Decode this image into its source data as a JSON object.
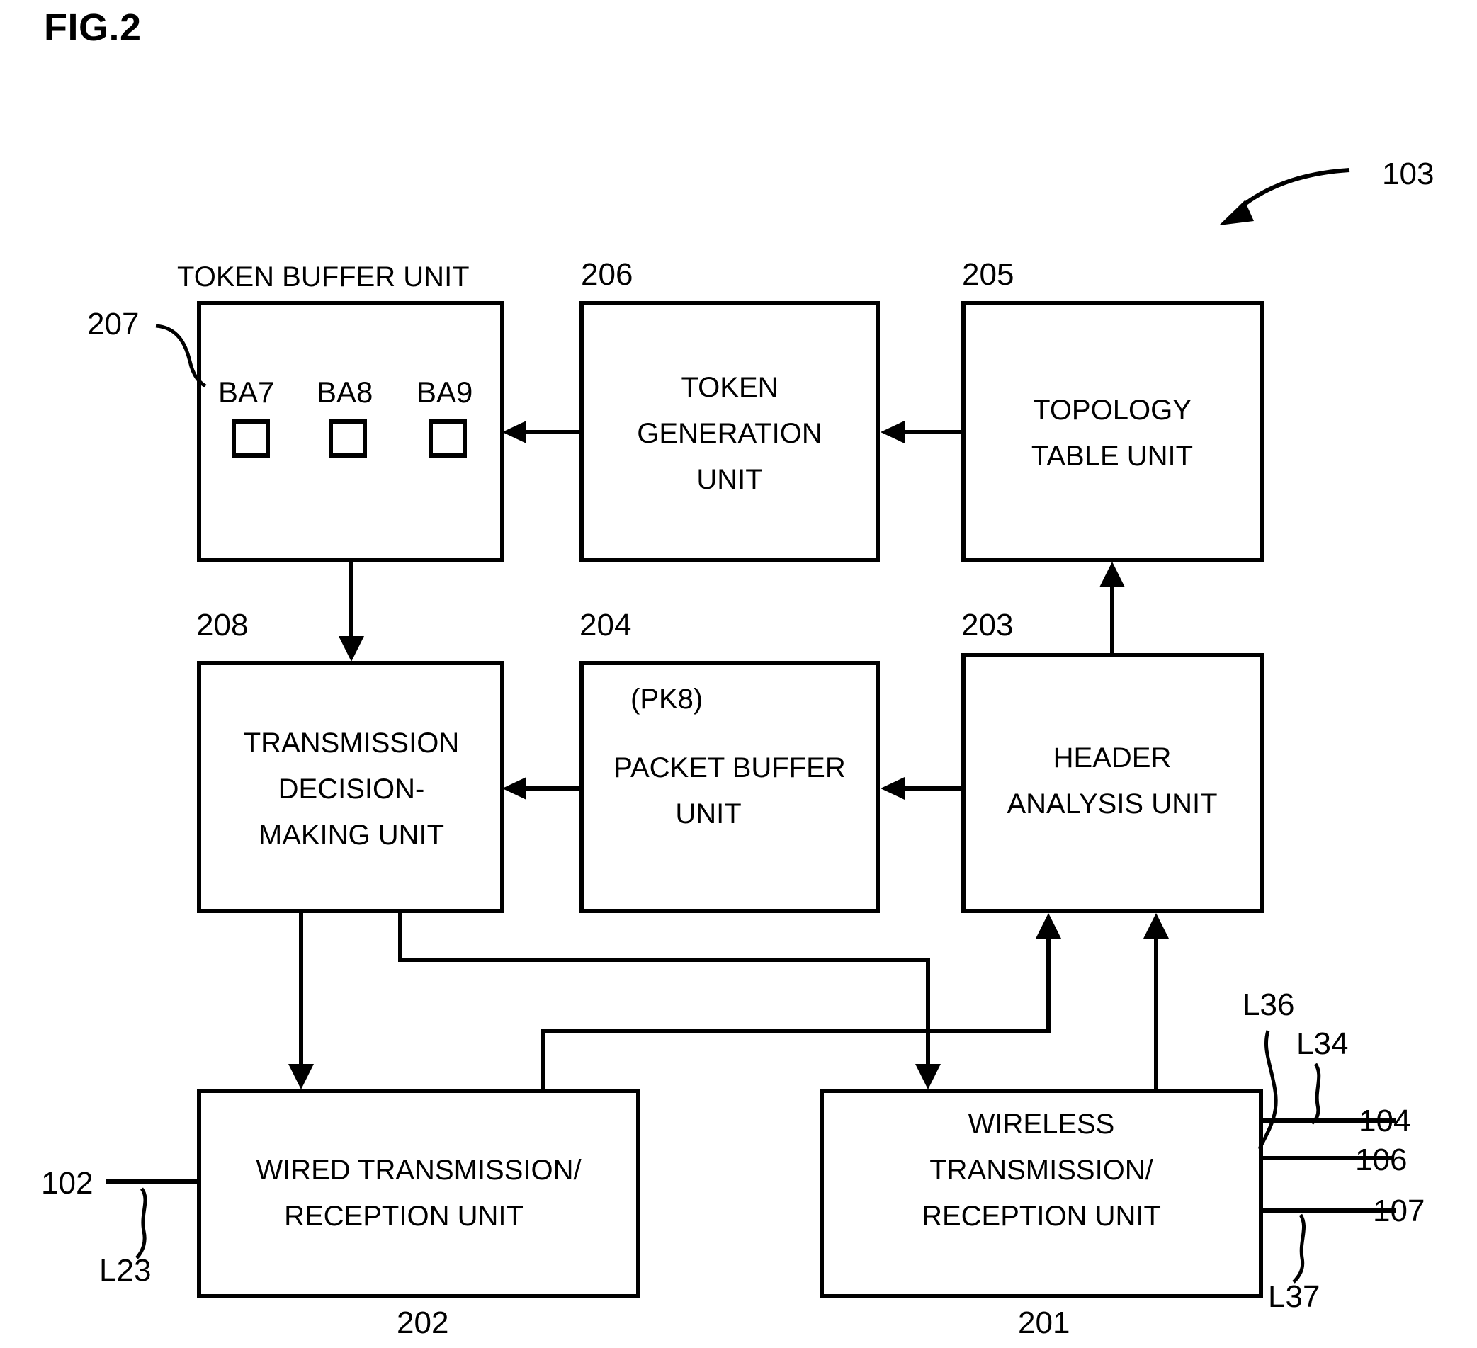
{
  "figure": {
    "title": "FIG.2",
    "overall_ref": "103"
  },
  "blocks": [
    {
      "id": "token-buffer-unit",
      "caption": "TOKEN BUFFER UNIT",
      "ref": "207",
      "tokens": [
        {
          "label": "BA7",
          "filled": false
        },
        {
          "label": "BA8",
          "filled": false
        },
        {
          "label": "BA9",
          "filled": false
        }
      ]
    },
    {
      "id": "token-generation-unit",
      "ref": "206",
      "lines": [
        "TOKEN",
        "GENERATION",
        "UNIT"
      ]
    },
    {
      "id": "topology-table-unit",
      "ref": "205",
      "lines": [
        "TOPOLOGY",
        "TABLE UNIT"
      ]
    },
    {
      "id": "transmission-decision-making-unit",
      "ref": "208",
      "lines": [
        "TRANSMISSION",
        "DECISION-",
        "MAKING UNIT"
      ]
    },
    {
      "id": "packet-buffer-unit",
      "ref": "204",
      "lines": [
        "(PK8)",
        "PACKET BUFFER",
        "UNIT"
      ]
    },
    {
      "id": "header-analysis-unit",
      "ref": "203",
      "lines": [
        "HEADER",
        "ANALYSIS UNIT"
      ]
    },
    {
      "id": "wired-transmission-reception-unit",
      "ref": "202",
      "lines": [
        "WIRED TRANSMISSION/",
        "RECEPTION UNIT"
      ]
    },
    {
      "id": "wireless-transmission-reception-unit",
      "ref": "201",
      "lines": [
        "WIRELESS",
        "TRANSMISSION/",
        "RECEPTION UNIT"
      ]
    }
  ],
  "labels": {
    "token_buffer_caption": "TOKEN BUFFER UNIT",
    "ref_207": "207",
    "ref_206": "206",
    "ref_205": "205",
    "ref_208": "208",
    "ref_204": "204",
    "ref_203": "203",
    "ref_202": "202",
    "ref_201": "201",
    "ref_103": "103",
    "ba7": "BA7",
    "ba8": "BA8",
    "ba9": "BA9",
    "token_l1": "TOKEN",
    "token_l2": "GENERATION",
    "token_l3": "UNIT",
    "topology_l1": "TOPOLOGY",
    "topology_l2": "TABLE UNIT",
    "tdm_l1": "TRANSMISSION",
    "tdm_l2": "DECISION-",
    "tdm_l3": "MAKING UNIT",
    "pkt_l1": "(PK8)",
    "pkt_l2": "PACKET BUFFER",
    "pkt_l3": "UNIT",
    "hdr_l1": "HEADER",
    "hdr_l2": "ANALYSIS UNIT",
    "wired_l1": "WIRED TRANSMISSION/",
    "wired_l2": "RECEPTION UNIT",
    "wireless_l1": "WIRELESS",
    "wireless_l2": "TRANSMISSION/",
    "wireless_l3": "RECEPTION UNIT",
    "left_port_102": "102",
    "left_port_L23": "L23",
    "right_L36": "L36",
    "right_L34": "L34",
    "right_104": "104",
    "right_106": "106",
    "right_107": "107",
    "right_L37": "L37"
  },
  "colors": {
    "ink": "#000000",
    "paper": "#ffffff"
  }
}
